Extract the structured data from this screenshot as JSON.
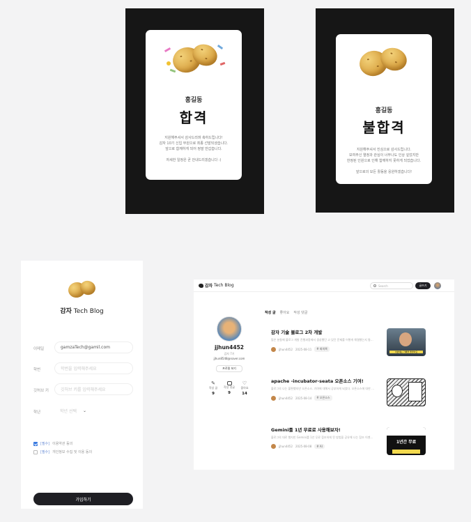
{
  "pass_card": {
    "name": "홍길동",
    "result": "합격",
    "messages": [
      "지원해주셔서 감사드리며 축하드립니다!",
      "감자 10기 신입 부원으로 최종 선발되셨습니다.",
      "앞으로 함께하게 되어 정말 반갑습니다.",
      "",
      "자세한 일정은 곧 안내드리겠습니다 :)"
    ]
  },
  "fail_card": {
    "name": "홍길동",
    "result": "불합격",
    "messages": [
      "지원해주셔서 진심으로 감사드립니다.",
      "보여주신 열정과 관심이 너무나도 인상 깊었지만",
      "한정된 인원으로 인해 함께하지 못하게 되었습니다.",
      "",
      "앞으로의 모든 활동을 응원하겠습니다!"
    ]
  },
  "signup": {
    "brand_bold": "감자",
    "brand_rest": " Tech Blog",
    "fields": [
      {
        "label": "이메일",
        "value": "gamzaTech@gamil.com"
      },
      {
        "label": "학번",
        "placeholder": "학번을 입력해주세요"
      },
      {
        "label": "깃허브 키",
        "placeholder": "깃허브 키를 입력해주세요"
      },
      {
        "label": "학년",
        "placeholder": "학년 선택"
      }
    ],
    "agreements": [
      {
        "required": "[필수]",
        "text": "이용약관 동의"
      },
      {
        "required": "[필수]",
        "text": "개인정보 수집 및 이용 동의"
      }
    ],
    "submit_label": "가입하기"
  },
  "blog": {
    "brand_bold": "감자",
    "brand_rest": " Tech Blog",
    "search_placeholder": "Search",
    "write_label": "글쓰기",
    "profile": {
      "username": "jjhun4452",
      "role": "감자 7기",
      "email": "jjhun8548@naver.com",
      "edit_label": "프로필 보기",
      "stats": [
        {
          "label": "작성 글",
          "value": "9"
        },
        {
          "label": "작성 댓글",
          "value": "9"
        },
        {
          "label": "좋아요",
          "value": "14"
        }
      ]
    },
    "tabs": [
      "작성 글",
      "좋아요",
      "작성 댓글"
    ],
    "posts": [
      {
        "title": "감자 기술 블로그 2차 개발",
        "desc": "많은 분들께 블로그 개발 진행과정에서 생성했던 고 있던 문제를 어떻게 해결했는지 통해 안전 오는 작업을 통...",
        "author": "jjhun4452",
        "date": "2025-08-11",
        "tag": "# 회의록",
        "thumb_text": "이번에는 기록을 들었어요"
      },
      {
        "title": "apache -incubator-seata 오픈소스 기여!",
        "desc": "블로그의 나는 불편했지만 오픈소스. 기여에 대해서 공부하게 되었다. 오픈소스에 대한 오픈소스를...",
        "author": "jjhun4452",
        "date": "2025-08-14",
        "tag": "# 오픈소스",
        "thumb_text": ""
      },
      {
        "title": "Gemini를 1년 무료로 사용해보자!",
        "desc": "블로그의 대로 했지만 Gemini를 1년 무료 참조하게 된 방법을 공유해 나는 참조 이벤트를 구독해...",
        "author": "jjhun4452",
        "date": "2025-08-08",
        "tag": "# AI",
        "thumb_text": "1년간 무료"
      }
    ]
  },
  "colors": {
    "accent": "#3b7be0",
    "dark": "#161616",
    "button": "#1f1f24"
  }
}
